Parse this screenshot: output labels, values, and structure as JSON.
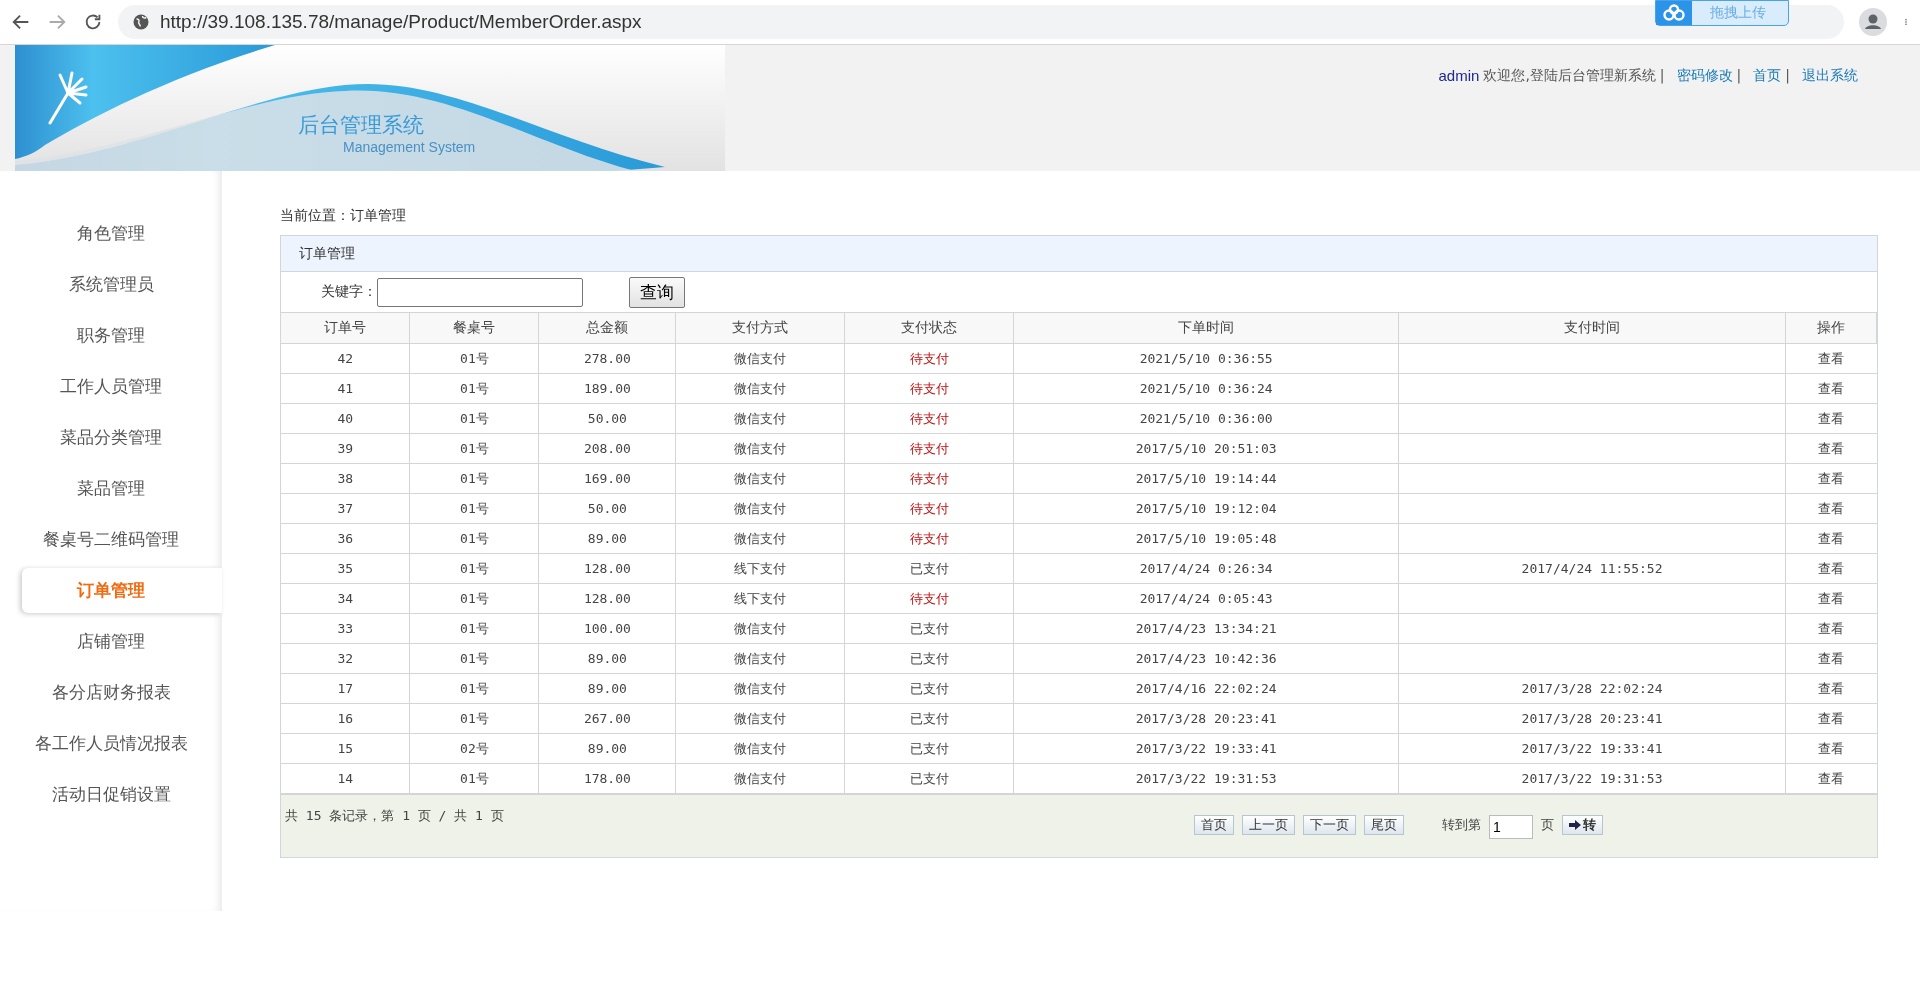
{
  "browser": {
    "url": "http://39.108.135.78/manage/Product/MemberOrder.aspx",
    "upload_button": "拖拽上传"
  },
  "header": {
    "title": "后台管理系统",
    "subtitle": "Management System",
    "user": "admin",
    "welcome": "欢迎您,登陆后台管理新系统",
    "separators": [
      "|",
      "|",
      "|"
    ],
    "links": [
      "密码修改",
      "首页",
      "退出系统"
    ]
  },
  "sidebar": {
    "items": [
      {
        "label": "角色管理",
        "selected": false
      },
      {
        "label": "系统管理员",
        "selected": false
      },
      {
        "label": "职务管理",
        "selected": false
      },
      {
        "label": "工作人员管理",
        "selected": false
      },
      {
        "label": "菜品分类管理",
        "selected": false
      },
      {
        "label": "菜品管理",
        "selected": false
      },
      {
        "label": "餐桌号二维码管理",
        "selected": false
      },
      {
        "label": "订单管理",
        "selected": true
      },
      {
        "label": "店铺管理",
        "selected": false
      },
      {
        "label": "各分店财务报表",
        "selected": false
      },
      {
        "label": "各工作人员情况报表",
        "selected": false
      },
      {
        "label": "活动日促销设置",
        "selected": false
      }
    ]
  },
  "breadcrumb": "当前位置：订单管理",
  "panel": {
    "title": "订单管理",
    "search_label": "关键字：",
    "search_button": "查询"
  },
  "table": {
    "columns": [
      "订单号",
      "餐桌号",
      "总金额",
      "支付方式",
      "支付状态",
      "下单时间",
      "支付时间",
      "操作"
    ],
    "rows": [
      {
        "id": "42",
        "table": "01号",
        "amount": "278.00",
        "method": "微信支付",
        "status": "待支付",
        "pending": true,
        "ordered": "2021/5/10 0:36:55",
        "paid_at": "",
        "action": "查看"
      },
      {
        "id": "41",
        "table": "01号",
        "amount": "189.00",
        "method": "微信支付",
        "status": "待支付",
        "pending": true,
        "ordered": "2021/5/10 0:36:24",
        "paid_at": "",
        "action": "查看"
      },
      {
        "id": "40",
        "table": "01号",
        "amount": "50.00",
        "method": "微信支付",
        "status": "待支付",
        "pending": true,
        "ordered": "2021/5/10 0:36:00",
        "paid_at": "",
        "action": "查看"
      },
      {
        "id": "39",
        "table": "01号",
        "amount": "208.00",
        "method": "微信支付",
        "status": "待支付",
        "pending": true,
        "ordered": "2017/5/10 20:51:03",
        "paid_at": "",
        "action": "查看"
      },
      {
        "id": "38",
        "table": "01号",
        "amount": "169.00",
        "method": "微信支付",
        "status": "待支付",
        "pending": true,
        "ordered": "2017/5/10 19:14:44",
        "paid_at": "",
        "action": "查看"
      },
      {
        "id": "37",
        "table": "01号",
        "amount": "50.00",
        "method": "微信支付",
        "status": "待支付",
        "pending": true,
        "ordered": "2017/5/10 19:12:04",
        "paid_at": "",
        "action": "查看"
      },
      {
        "id": "36",
        "table": "01号",
        "amount": "89.00",
        "method": "微信支付",
        "status": "待支付",
        "pending": true,
        "ordered": "2017/5/10 19:05:48",
        "paid_at": "",
        "action": "查看"
      },
      {
        "id": "35",
        "table": "01号",
        "amount": "128.00",
        "method": "线下支付",
        "status": "已支付",
        "pending": false,
        "ordered": "2017/4/24 0:26:34",
        "paid_at": "2017/4/24 11:55:52",
        "action": "查看"
      },
      {
        "id": "34",
        "table": "01号",
        "amount": "128.00",
        "method": "线下支付",
        "status": "待支付",
        "pending": true,
        "ordered": "2017/4/24 0:05:43",
        "paid_at": "",
        "action": "查看"
      },
      {
        "id": "33",
        "table": "01号",
        "amount": "100.00",
        "method": "微信支付",
        "status": "已支付",
        "pending": false,
        "ordered": "2017/4/23 13:34:21",
        "paid_at": "",
        "action": "查看"
      },
      {
        "id": "32",
        "table": "01号",
        "amount": "89.00",
        "method": "微信支付",
        "status": "已支付",
        "pending": false,
        "ordered": "2017/4/23 10:42:36",
        "paid_at": "",
        "action": "查看"
      },
      {
        "id": "17",
        "table": "01号",
        "amount": "89.00",
        "method": "微信支付",
        "status": "已支付",
        "pending": false,
        "ordered": "2017/4/16 22:02:24",
        "paid_at": "2017/3/28 22:02:24",
        "action": "查看"
      },
      {
        "id": "16",
        "table": "01号",
        "amount": "267.00",
        "method": "微信支付",
        "status": "已支付",
        "pending": false,
        "ordered": "2017/3/28 20:23:41",
        "paid_at": "2017/3/28 20:23:41",
        "action": "查看"
      },
      {
        "id": "15",
        "table": "02号",
        "amount": "89.00",
        "method": "微信支付",
        "status": "已支付",
        "pending": false,
        "ordered": "2017/3/22 19:33:41",
        "paid_at": "2017/3/22 19:33:41",
        "action": "查看"
      },
      {
        "id": "14",
        "table": "01号",
        "amount": "178.00",
        "method": "微信支付",
        "status": "已支付",
        "pending": false,
        "ordered": "2017/3/22 19:31:53",
        "paid_at": "2017/3/22 19:31:53",
        "action": "查看"
      }
    ]
  },
  "pager": {
    "summary": "共 15 条记录，第 1 页 / 共 1 页",
    "buttons": [
      "首页",
      "上一页",
      "下一页",
      "尾页"
    ],
    "goto_label": "转到第",
    "page_value": "1",
    "page_suffix": "页",
    "go_button": "转"
  }
}
